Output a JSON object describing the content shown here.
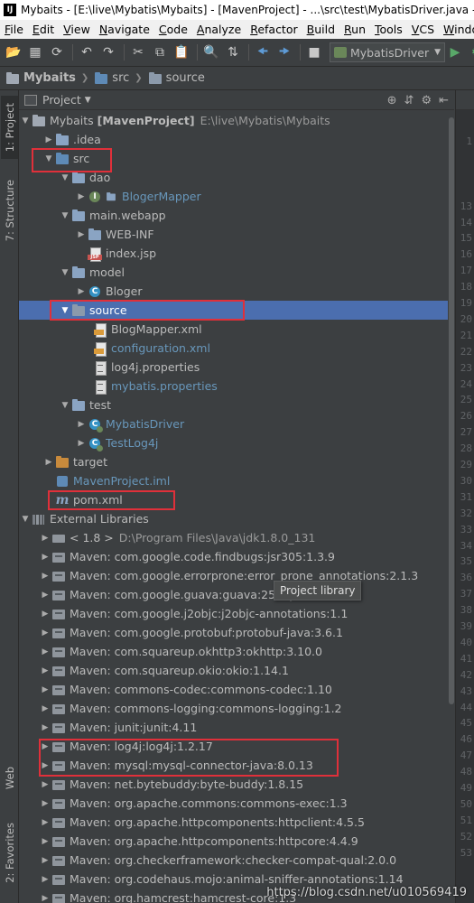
{
  "window": {
    "title": "Mybaits - [E:\\live\\Mybatis\\Mybaits] - [MavenProject] - ...\\src\\test\\MybatisDriver.java - In"
  },
  "menu": [
    "File",
    "Edit",
    "View",
    "Navigate",
    "Code",
    "Analyze",
    "Refactor",
    "Build",
    "Run",
    "Tools",
    "VCS",
    "Windo"
  ],
  "toolbar": {
    "run_config": "MybatisDriver"
  },
  "breadcrumb": [
    "Mybaits",
    "src",
    "source"
  ],
  "left_tabs": {
    "project": "1: Project",
    "structure": "7: Structure",
    "web": "Web",
    "favorites": "2: Favorites"
  },
  "panel": {
    "title": "Project"
  },
  "tree": {
    "root": {
      "name": "Mybaits",
      "module": "[MavenProject]",
      "path": "E:\\live\\Mybatis\\Mybaits"
    },
    "idea": ".idea",
    "src": "src",
    "dao": "dao",
    "blogermapper": "BlogerMapper",
    "mainwebapp": "main.webapp",
    "webinf": "WEB-INF",
    "indexjsp": "index.jsp",
    "model": "model",
    "bloger": "Bloger",
    "source": "source",
    "blogmapperxml": "BlogMapper.xml",
    "configxml": "configuration.xml",
    "log4j": "log4j.properties",
    "mybatisprops": "mybatis.properties",
    "test": "test",
    "mybatisdriver": "MybatisDriver",
    "testlog4j": "TestLog4j",
    "target": "target",
    "iml": "MavenProject.iml",
    "pom": "pom.xml",
    "extlibs": "External Libraries",
    "jdk": {
      "name": "< 1.8 >",
      "path": "D:\\Program Files\\Java\\jdk1.8.0_131"
    }
  },
  "libraries": [
    "Maven: com.google.code.findbugs:jsr305:1.3.9",
    "Maven: com.google.errorprone:error_prone_annotations:2.1.3",
    "Maven: com.google.guava:guava:25.0-jre",
    "Maven: com.google.j2objc:j2objc-annotations:1.1",
    "Maven: com.google.protobuf:protobuf-java:3.6.1",
    "Maven: com.squareup.okhttp3:okhttp:3.10.0",
    "Maven: com.squareup.okio:okio:1.14.1",
    "Maven: commons-codec:commons-codec:1.10",
    "Maven: commons-logging:commons-logging:1.2",
    "Maven: junit:junit:4.11",
    "Maven: log4j:log4j:1.2.17",
    "Maven: mysql:mysql-connector-java:8.0.13",
    "Maven: net.bytebuddy:byte-buddy:1.8.15",
    "Maven: org.apache.commons:commons-exec:1.3",
    "Maven: org.apache.httpcomponents:httpclient:4.5.5",
    "Maven: org.apache.httpcomponents:httpcore:4.4.9",
    "Maven: org.checkerframework:checker-compat-qual:2.0.0",
    "Maven: org.codehaus.mojo:animal-sniffer-annotations:1.14",
    "Maven: org.hamcrest:hamcrest-core:1.3"
  ],
  "tooltip": "Project library",
  "line_numbers": [
    "1",
    "",
    "",
    "",
    "13",
    "14",
    "15",
    "16",
    "17",
    "18",
    "19",
    "20",
    "21",
    "22",
    "23",
    "24",
    "25",
    "26",
    "27",
    "28",
    "29",
    "30",
    "31",
    "32",
    "33",
    "34",
    "35",
    "36",
    "37",
    "38",
    "39",
    "40",
    "41",
    "42",
    "43",
    "44",
    "45",
    "46",
    "47",
    "48",
    "49",
    "50",
    "51",
    "52",
    "53"
  ],
  "watermark": "https://blog.csdn.net/u010569419",
  "colors": {
    "selection": "#4b6eaf",
    "annotation": "#e0303a",
    "background": "#3c3f41"
  }
}
